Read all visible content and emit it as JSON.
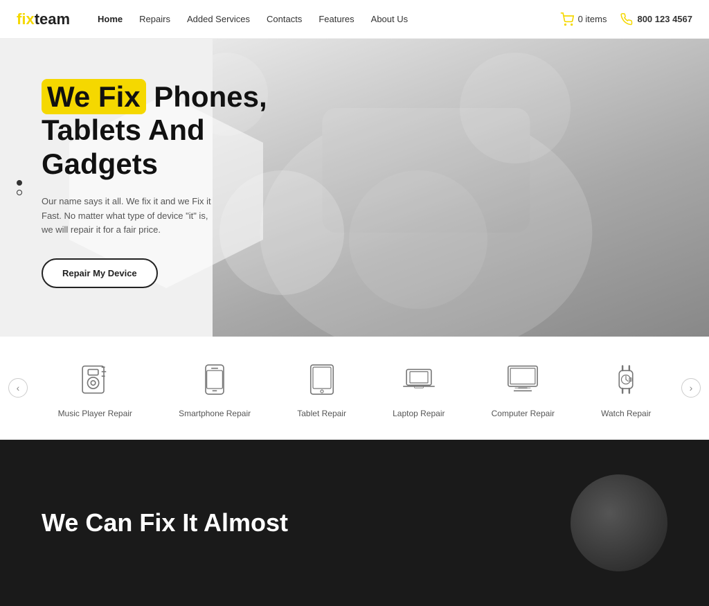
{
  "brand": {
    "name_prefix": "fix",
    "name_suffix": "team"
  },
  "nav": {
    "links": [
      {
        "label": "Home",
        "active": true
      },
      {
        "label": "Repairs",
        "active": false
      },
      {
        "label": "Added Services",
        "active": false
      },
      {
        "label": "Contacts",
        "active": false
      },
      {
        "label": "Features",
        "active": false
      },
      {
        "label": "About Us",
        "active": false
      }
    ],
    "cart_label": "0 items",
    "phone": "800 123 4567"
  },
  "hero": {
    "headline_highlight": "We Fix",
    "headline_rest": " Phones,\nTablets And\nGadgets",
    "subtext": "Our name says it all. We fix it and we Fix it Fast. No matter what type of device \"it\" is, we will repair it for a fair price.",
    "cta_label": "Repair My Device"
  },
  "services": {
    "prev_label": "‹",
    "next_label": "›",
    "items": [
      {
        "label": "Music Player Repair",
        "icon": "music-player"
      },
      {
        "label": "Smartphone Repair",
        "icon": "smartphone"
      },
      {
        "label": "Tablet Repair",
        "icon": "tablet"
      },
      {
        "label": "Laptop Repair",
        "icon": "laptop"
      },
      {
        "label": "Computer Repair",
        "icon": "computer"
      },
      {
        "label": "Watch Repair",
        "icon": "watch"
      }
    ]
  },
  "dark_section": {
    "title_line1": "We Can Fix It Almost"
  }
}
